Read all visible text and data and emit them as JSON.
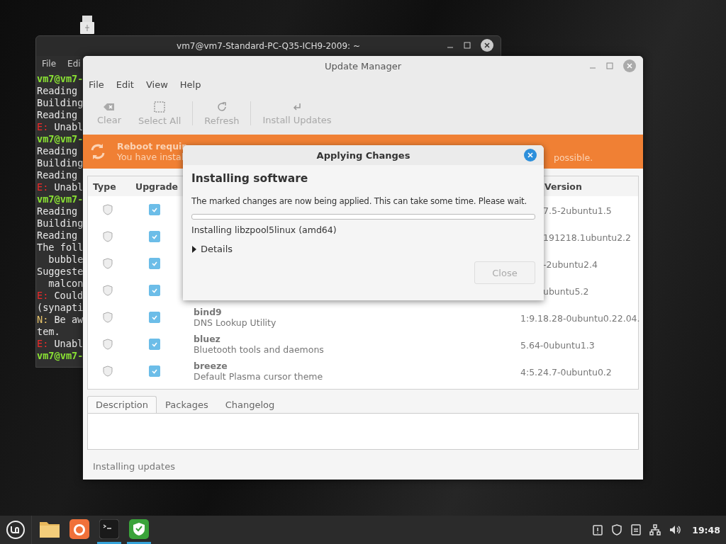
{
  "terminal": {
    "title": "vm7@vm7-Standard-PC-Q35-ICH9-2009: ~",
    "menu": [
      "File",
      "Edi"
    ],
    "lines": [
      {
        "kind": "prompt",
        "text": "vm7@vm7-"
      },
      {
        "kind": "plain",
        "text": "Reading "
      },
      {
        "kind": "plain",
        "text": "Building"
      },
      {
        "kind": "plain",
        "text": "Reading "
      },
      {
        "kind": "error",
        "prefix": "E:",
        "text": "Unabl"
      },
      {
        "kind": "prompt",
        "text": "vm7@vm7-"
      },
      {
        "kind": "plain",
        "text": "Reading "
      },
      {
        "kind": "plain",
        "text": "Building"
      },
      {
        "kind": "plain",
        "text": "Reading "
      },
      {
        "kind": "error",
        "prefix": "E:",
        "text": "Unabl"
      },
      {
        "kind": "prompt",
        "text": "vm7@vm7-"
      },
      {
        "kind": "plain",
        "text": "Reading "
      },
      {
        "kind": "plain",
        "text": "Building"
      },
      {
        "kind": "plain",
        "text": "Reading "
      },
      {
        "kind": "plain",
        "text": "The foll"
      },
      {
        "kind": "plain",
        "text": "  bubble"
      },
      {
        "kind": "plain",
        "text": "Suggeste"
      },
      {
        "kind": "plain",
        "text": "  malcon"
      },
      {
        "kind": "error",
        "prefix": "E:",
        "text": "Could"
      },
      {
        "kind": "plain",
        "text": "(synapti"
      },
      {
        "kind": "note",
        "prefix": "N:",
        "text": "Be aw"
      },
      {
        "kind": "plain",
        "text": "tem."
      },
      {
        "kind": "error",
        "prefix": "E:",
        "text": "Unabl"
      },
      {
        "kind": "prompt",
        "text": "vm7@vm7-"
      }
    ]
  },
  "update_manager": {
    "title": "Update Manager",
    "menu": [
      "File",
      "Edit",
      "View",
      "Help"
    ],
    "toolbar": [
      {
        "kind": "clear",
        "label": "Clear",
        "disabled": true
      },
      {
        "kind": "select",
        "label": "Select All",
        "disabled": true
      },
      {
        "kind": "refresh",
        "label": "Refresh",
        "disabled": true
      },
      {
        "kind": "install",
        "label": "Install Updates",
        "disabled": true
      }
    ],
    "banner": {
      "title": "Reboot requir",
      "message": "You have instal",
      "message_end": "possible."
    },
    "table": {
      "columns": [
        "Type",
        "Upgrade",
        "Version"
      ],
      "rows": [
        {
          "checked": true,
          "version": "7.5-2ubuntu1.5"
        },
        {
          "checked": true,
          "version": "191218.1ubuntu2.2"
        },
        {
          "checked": true,
          "version": "-2ubuntu2.4"
        },
        {
          "checked": true,
          "version": "ubuntu5.2"
        },
        {
          "checked": true,
          "name": "bind9",
          "description": "DNS Lookup Utility",
          "version": "1:9.18.28-0ubuntu0.22.04."
        },
        {
          "checked": true,
          "name": "bluez",
          "description": "Bluetooth tools and daemons",
          "version": "5.64-0ubuntu1.3"
        },
        {
          "checked": true,
          "name": "breeze",
          "description": "Default Plasma cursor theme",
          "version": "4:5.24.7-0ubuntu0.2"
        }
      ]
    },
    "tabs": [
      {
        "label": "Description",
        "selected": true
      },
      {
        "label": "Packages",
        "selected": false
      },
      {
        "label": "Changelog",
        "selected": false
      }
    ],
    "status": "Installing updates"
  },
  "dialog": {
    "title": "Applying Changes",
    "heading": "Installing software",
    "message": "The marked changes are now being applied. This can take some time. Please wait.",
    "progress": {
      "level": 0
    },
    "current": "Installing libzpool5linux (amd64)",
    "details": {
      "label": "Details",
      "expanded": false
    },
    "close_button": {
      "label": "Close",
      "disabled": true
    }
  },
  "taskbar": {
    "apps": [
      {
        "kind": "folder",
        "active": false
      },
      {
        "kind": "browser",
        "active": false
      },
      {
        "kind": "terminal",
        "active": true
      },
      {
        "kind": "shield",
        "active": true
      }
    ],
    "clock": "19:48"
  }
}
